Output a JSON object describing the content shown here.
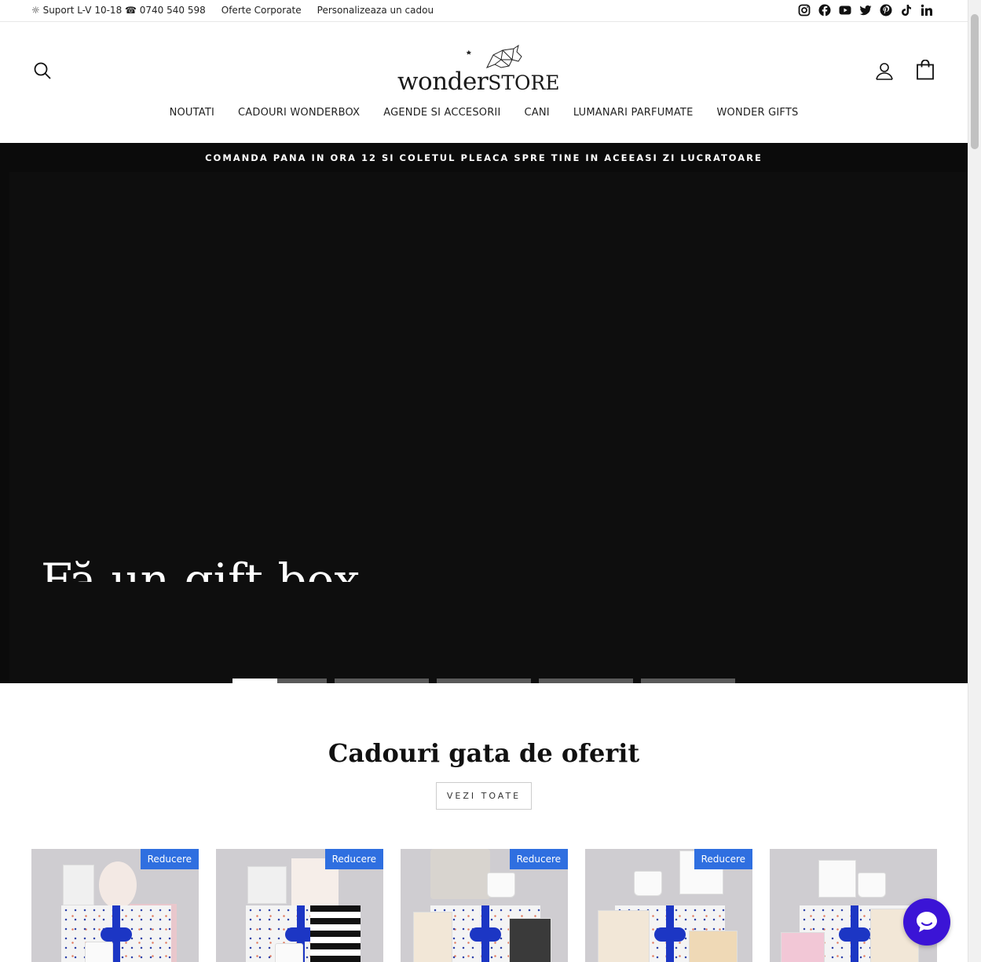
{
  "topbar": {
    "support": "☼ Suport L-V 10-18 ☎ 0740 540 598",
    "corporate": "Oferte Corporate",
    "personalize": "Personalizeaza un cadou",
    "social_icons": [
      "instagram-icon",
      "facebook-icon",
      "youtube-icon",
      "twitter-icon",
      "pinterest-icon",
      "tiktok-icon",
      "linkedin-icon"
    ]
  },
  "logo": {
    "text_main": "wonder",
    "text_bold": "STORE"
  },
  "nav": {
    "items": [
      "NOUTATI",
      "CADOURI WONDERBOX",
      "AGENDE SI ACCESORII",
      "CANI",
      "LUMANARI PARFUMATE",
      "WONDER GIFTS"
    ]
  },
  "announcement": "COMANDA PANA IN ORA 12 SI COLETUL PLEACA SPRE TINE IN ACEEASI ZI LUCRATOARE",
  "hero": {
    "title": "Fă un gift box",
    "slides_count": 6,
    "active_slide": 1,
    "active_progress": 0.475
  },
  "section": {
    "title": "Cadouri gata de oferit",
    "view_all": "VEZI TOATE"
  },
  "products": [
    {
      "badge": "Reducere"
    },
    {
      "badge": "Reducere"
    },
    {
      "badge": "Reducere"
    },
    {
      "badge": "Reducere"
    },
    {
      "badge": ""
    }
  ],
  "colors": {
    "announcement_bg": "#0b0b0b",
    "badge": "#2f6fe0",
    "chat": "#3b14d6",
    "ribbon": "#1c36c4"
  }
}
